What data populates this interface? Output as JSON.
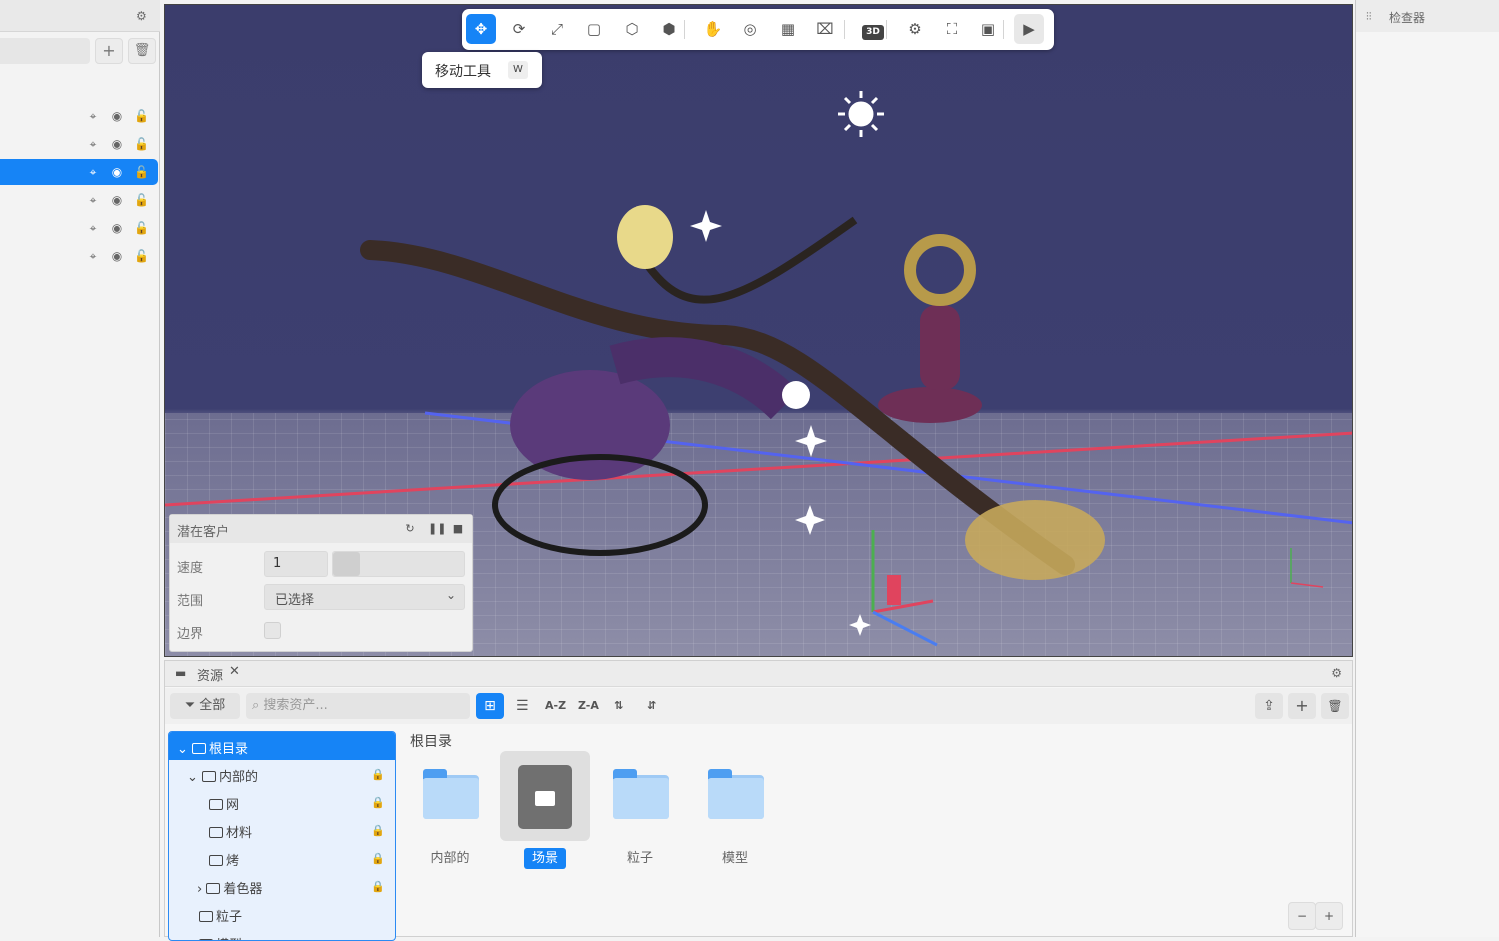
{
  "hierarchy": {
    "row_count": 6,
    "selected_index": 2
  },
  "toolbar": {
    "tools": [
      {
        "name": "move-tool",
        "glyph": "✥",
        "active": true
      },
      {
        "name": "rotate-tool",
        "glyph": "⟳"
      },
      {
        "name": "scale-tool",
        "glyph": "⤢"
      },
      {
        "name": "rect-tool",
        "glyph": "▢"
      },
      {
        "name": "wireframe-tool",
        "glyph": "⬡"
      },
      {
        "name": "solid-tool",
        "glyph": "⬢"
      },
      {
        "name": "hand-tool",
        "glyph": "✋"
      },
      {
        "name": "focus-tool",
        "glyph": "◎"
      },
      {
        "name": "grid-tool",
        "glyph": "▦"
      },
      {
        "name": "camera-tool",
        "glyph": "⌧"
      },
      {
        "name": "mode-3d",
        "glyph": "3D"
      },
      {
        "name": "settings-tool",
        "glyph": "⚙"
      },
      {
        "name": "fullscreen-tool",
        "glyph": "⛶"
      },
      {
        "name": "screenshot-tool",
        "glyph": "▣"
      },
      {
        "name": "play-button",
        "glyph": "▶"
      }
    ],
    "tooltip": {
      "label": "移动工具",
      "key": "W"
    }
  },
  "stats": {
    "title": "潜在客户",
    "speed_label": "速度",
    "speed_value": "1",
    "range_label": "范围",
    "range_value": "已选择",
    "border_label": "边界"
  },
  "inspector": {
    "title": "检查器"
  },
  "assets": {
    "tab": "资源",
    "filter_label": "全部",
    "search_placeholder": "搜索资产...",
    "sort_az": "A-Z",
    "sort_za": "Z-A",
    "breadcrumb": "根目录",
    "tree": [
      {
        "label": "根目录",
        "depth": 0,
        "expander": "⌄",
        "root": true
      },
      {
        "label": "内部的",
        "depth": 1,
        "expander": "⌄",
        "locked": true
      },
      {
        "label": "网",
        "depth": 2,
        "locked": true
      },
      {
        "label": "材料",
        "depth": 2,
        "locked": true
      },
      {
        "label": "烤",
        "depth": 2,
        "locked": true
      },
      {
        "label": "着色器",
        "depth": 2,
        "expander": "›",
        "locked": true
      },
      {
        "label": "粒子",
        "depth": 1
      },
      {
        "label": "模型",
        "depth": 1
      }
    ],
    "tiles": [
      {
        "label": "内部的",
        "kind": "folder"
      },
      {
        "label": "场景",
        "kind": "scene",
        "selected": true
      },
      {
        "label": "粒子",
        "kind": "folder"
      },
      {
        "label": "模型",
        "kind": "folder"
      }
    ]
  }
}
